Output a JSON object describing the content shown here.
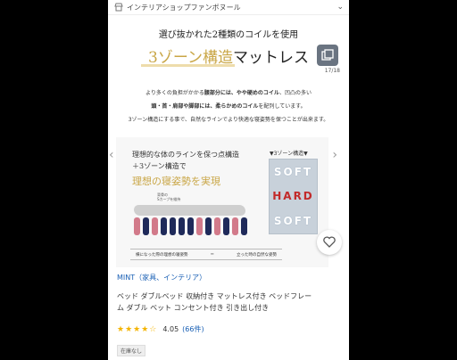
{
  "header": {
    "shop_name": "インテリアショップファンボヌール",
    "shop_icon": "store-icon",
    "dropdown_icon": "chevron-down-icon"
  },
  "image": {
    "headline_small": "選び抜かれた2種類のコイルを使用",
    "headline_accent": "3ゾーン構造",
    "headline_rest": "マットレス",
    "counter": "17/18",
    "desc_line1_a": "より多くの負担がかかる",
    "desc_line1_b": "腰部分には、やや硬めのコイル",
    "desc_line1_c": "、凹凸の多い",
    "desc_line2_a": "頭・首・肩部や脚部には、柔らかめのコイル",
    "desc_line2_b": "を配列しています。",
    "desc_line3": "3ゾーン構造にする事で、自然なラインでより快適な寝姿勢を保つことが出来ます。",
    "panel_line1": "理想的な体のラインを保つ点構造",
    "panel_line2": "＋3ゾーン構造で",
    "panel_line3": "理想の寝姿勢を実現",
    "spine_label_1": "背骨の",
    "spine_label_2": "Sカーブを維持",
    "zone_title": "▼3ゾーン構造▼",
    "zone_top": "SOFT",
    "zone_middle": "HARD",
    "zone_bottom": "SOFT",
    "footer_left": "横になった際の理想の寝姿勢",
    "footer_mid": "＝",
    "footer_right": "立った時の自然な姿勢"
  },
  "product": {
    "brand": "MINT（家具、インテリア）",
    "title_line1": "ベッド ダブルベッド 収納付き マットレス付き ベッドフレー",
    "title_line2": "ム ダブル ベット コンセント付き 引き出し付き",
    "stars": "★★★★☆",
    "rating": "4.05",
    "review_count": "(66件)",
    "stock": "在庫なし"
  },
  "colors": {
    "accent_gold": "#c9a646",
    "link_blue": "#1a60b5",
    "coil_navy": "#1f2a5a",
    "coil_pink": "#d27a8a"
  }
}
